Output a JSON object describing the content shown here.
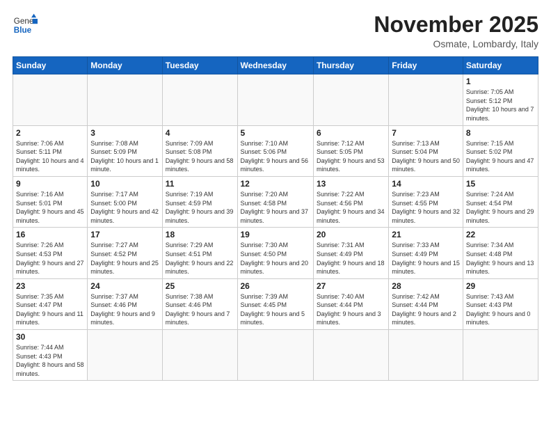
{
  "header": {
    "logo_general": "General",
    "logo_blue": "Blue",
    "month": "November 2025",
    "location": "Osmate, Lombardy, Italy"
  },
  "weekdays": [
    "Sunday",
    "Monday",
    "Tuesday",
    "Wednesday",
    "Thursday",
    "Friday",
    "Saturday"
  ],
  "weeks": [
    [
      {
        "day": "",
        "info": ""
      },
      {
        "day": "",
        "info": ""
      },
      {
        "day": "",
        "info": ""
      },
      {
        "day": "",
        "info": ""
      },
      {
        "day": "",
        "info": ""
      },
      {
        "day": "",
        "info": ""
      },
      {
        "day": "1",
        "info": "Sunrise: 7:05 AM\nSunset: 5:12 PM\nDaylight: 10 hours and 7 minutes."
      }
    ],
    [
      {
        "day": "2",
        "info": "Sunrise: 7:06 AM\nSunset: 5:11 PM\nDaylight: 10 hours and 4 minutes."
      },
      {
        "day": "3",
        "info": "Sunrise: 7:08 AM\nSunset: 5:09 PM\nDaylight: 10 hours and 1 minute."
      },
      {
        "day": "4",
        "info": "Sunrise: 7:09 AM\nSunset: 5:08 PM\nDaylight: 9 hours and 58 minutes."
      },
      {
        "day": "5",
        "info": "Sunrise: 7:10 AM\nSunset: 5:06 PM\nDaylight: 9 hours and 56 minutes."
      },
      {
        "day": "6",
        "info": "Sunrise: 7:12 AM\nSunset: 5:05 PM\nDaylight: 9 hours and 53 minutes."
      },
      {
        "day": "7",
        "info": "Sunrise: 7:13 AM\nSunset: 5:04 PM\nDaylight: 9 hours and 50 minutes."
      },
      {
        "day": "8",
        "info": "Sunrise: 7:15 AM\nSunset: 5:02 PM\nDaylight: 9 hours and 47 minutes."
      }
    ],
    [
      {
        "day": "9",
        "info": "Sunrise: 7:16 AM\nSunset: 5:01 PM\nDaylight: 9 hours and 45 minutes."
      },
      {
        "day": "10",
        "info": "Sunrise: 7:17 AM\nSunset: 5:00 PM\nDaylight: 9 hours and 42 minutes."
      },
      {
        "day": "11",
        "info": "Sunrise: 7:19 AM\nSunset: 4:59 PM\nDaylight: 9 hours and 39 minutes."
      },
      {
        "day": "12",
        "info": "Sunrise: 7:20 AM\nSunset: 4:58 PM\nDaylight: 9 hours and 37 minutes."
      },
      {
        "day": "13",
        "info": "Sunrise: 7:22 AM\nSunset: 4:56 PM\nDaylight: 9 hours and 34 minutes."
      },
      {
        "day": "14",
        "info": "Sunrise: 7:23 AM\nSunset: 4:55 PM\nDaylight: 9 hours and 32 minutes."
      },
      {
        "day": "15",
        "info": "Sunrise: 7:24 AM\nSunset: 4:54 PM\nDaylight: 9 hours and 29 minutes."
      }
    ],
    [
      {
        "day": "16",
        "info": "Sunrise: 7:26 AM\nSunset: 4:53 PM\nDaylight: 9 hours and 27 minutes."
      },
      {
        "day": "17",
        "info": "Sunrise: 7:27 AM\nSunset: 4:52 PM\nDaylight: 9 hours and 25 minutes."
      },
      {
        "day": "18",
        "info": "Sunrise: 7:29 AM\nSunset: 4:51 PM\nDaylight: 9 hours and 22 minutes."
      },
      {
        "day": "19",
        "info": "Sunrise: 7:30 AM\nSunset: 4:50 PM\nDaylight: 9 hours and 20 minutes."
      },
      {
        "day": "20",
        "info": "Sunrise: 7:31 AM\nSunset: 4:49 PM\nDaylight: 9 hours and 18 minutes."
      },
      {
        "day": "21",
        "info": "Sunrise: 7:33 AM\nSunset: 4:49 PM\nDaylight: 9 hours and 15 minutes."
      },
      {
        "day": "22",
        "info": "Sunrise: 7:34 AM\nSunset: 4:48 PM\nDaylight: 9 hours and 13 minutes."
      }
    ],
    [
      {
        "day": "23",
        "info": "Sunrise: 7:35 AM\nSunset: 4:47 PM\nDaylight: 9 hours and 11 minutes."
      },
      {
        "day": "24",
        "info": "Sunrise: 7:37 AM\nSunset: 4:46 PM\nDaylight: 9 hours and 9 minutes."
      },
      {
        "day": "25",
        "info": "Sunrise: 7:38 AM\nSunset: 4:46 PM\nDaylight: 9 hours and 7 minutes."
      },
      {
        "day": "26",
        "info": "Sunrise: 7:39 AM\nSunset: 4:45 PM\nDaylight: 9 hours and 5 minutes."
      },
      {
        "day": "27",
        "info": "Sunrise: 7:40 AM\nSunset: 4:44 PM\nDaylight: 9 hours and 3 minutes."
      },
      {
        "day": "28",
        "info": "Sunrise: 7:42 AM\nSunset: 4:44 PM\nDaylight: 9 hours and 2 minutes."
      },
      {
        "day": "29",
        "info": "Sunrise: 7:43 AM\nSunset: 4:43 PM\nDaylight: 9 hours and 0 minutes."
      }
    ],
    [
      {
        "day": "30",
        "info": "Sunrise: 7:44 AM\nSunset: 4:43 PM\nDaylight: 8 hours and 58 minutes."
      },
      {
        "day": "",
        "info": ""
      },
      {
        "day": "",
        "info": ""
      },
      {
        "day": "",
        "info": ""
      },
      {
        "day": "",
        "info": ""
      },
      {
        "day": "",
        "info": ""
      },
      {
        "day": "",
        "info": ""
      }
    ]
  ]
}
